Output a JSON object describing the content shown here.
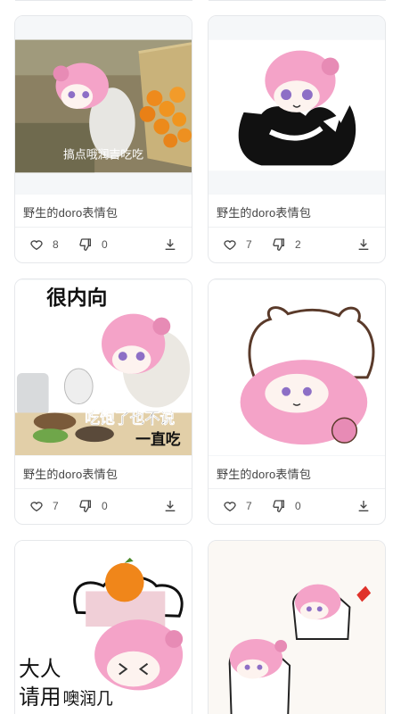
{
  "cards": [
    {
      "title": "野生的doro表情包",
      "likes": "8",
      "dislikes": "0",
      "image": {
        "caption": "搞点哦润吉吃吃",
        "icon": "doro-orange-basket-image"
      }
    },
    {
      "title": "野生的doro表情包",
      "likes": "7",
      "dislikes": "2",
      "image": {
        "caption": "",
        "icon": "doro-black-creature-image"
      }
    },
    {
      "title": "野生的doro表情包",
      "likes": "7",
      "dislikes": "0",
      "image": {
        "caption_top": "很内向",
        "caption_bottom_1": "吃饱了也不说",
        "caption_bottom_2": "一直吃",
        "icon": "doro-eating-image"
      }
    },
    {
      "title": "野生的doro表情包",
      "likes": "7",
      "dislikes": "0",
      "image": {
        "caption": "",
        "icon": "doro-bear-costume-image"
      }
    },
    {
      "title": "",
      "likes": "",
      "dislikes": "",
      "image": {
        "caption_1": "大人",
        "caption_2": "请用",
        "caption_3": "噢润几",
        "icon": "doro-orange-offer-image"
      }
    },
    {
      "title": "",
      "likes": "",
      "dislikes": "",
      "image": {
        "caption": "",
        "icon": "doro-ghost-pair-image"
      }
    }
  ],
  "colors": {
    "border": "#e6e8eb",
    "thumb_bg": "#f4f6f8",
    "pink": "#f4a3c8",
    "text": "#444444"
  },
  "icons": {
    "like": "heart-icon",
    "dislike": "thumbs-down-icon",
    "download": "download-icon"
  }
}
